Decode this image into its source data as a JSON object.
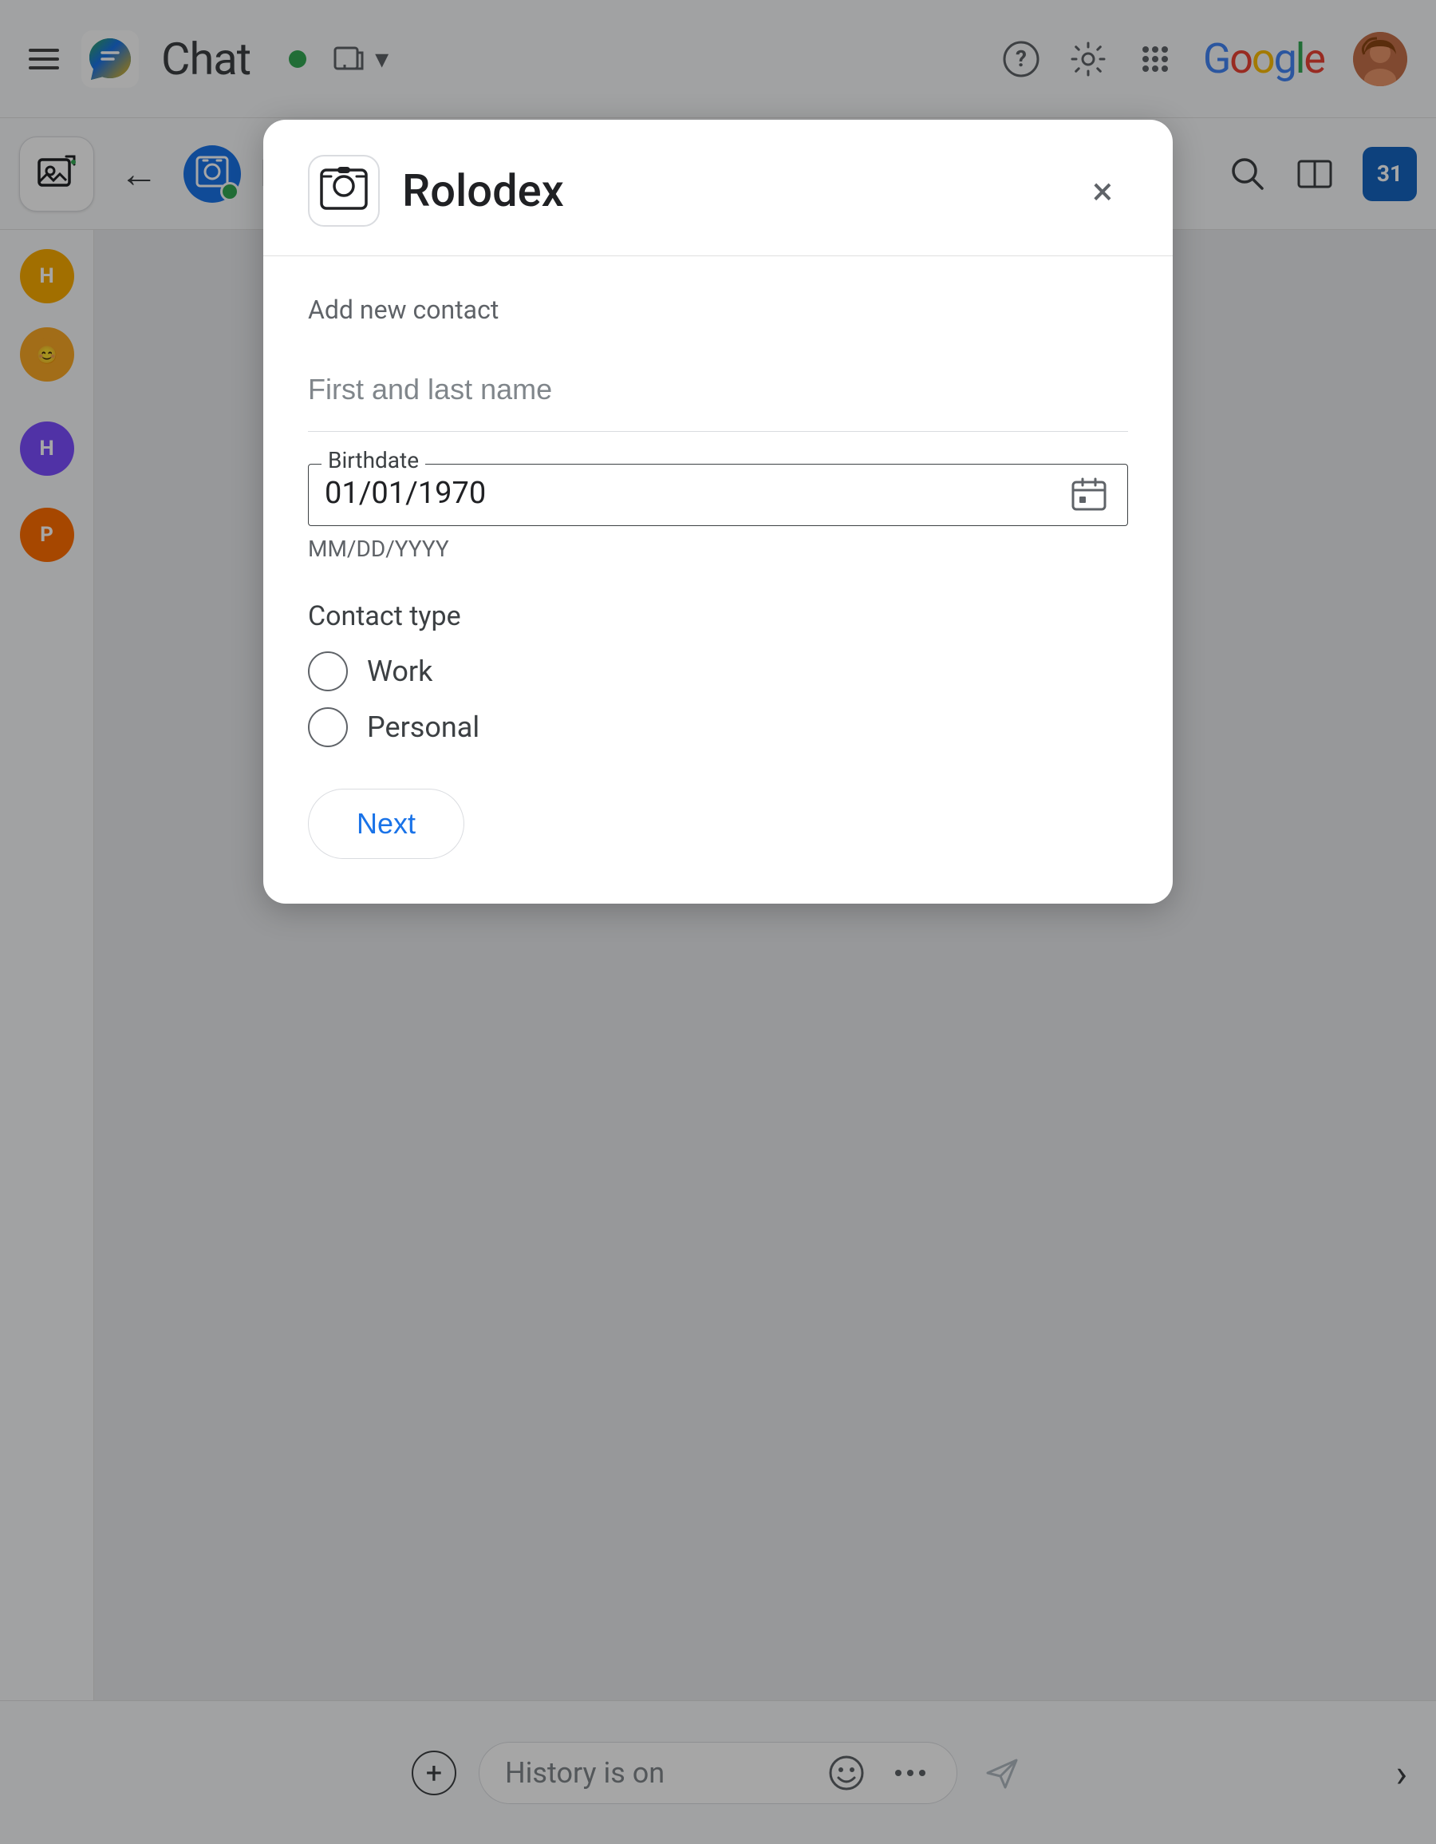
{
  "app": {
    "title": "Chat",
    "logo_alt": "Google Chat logo"
  },
  "topbar": {
    "status": "online",
    "window_label": "window",
    "help_label": "help",
    "settings_label": "settings",
    "apps_label": "apps",
    "google_label": "Google",
    "avatar_alt": "User avatar"
  },
  "secondbar": {
    "contact_name": "Rolodex",
    "search_label": "search",
    "split_label": "split view",
    "calendar_day": "31"
  },
  "sidebar": {
    "items": [
      {
        "label": "H",
        "color": "yellow",
        "aria": "H contact"
      },
      {
        "label": "P",
        "color": "orange",
        "aria": "P contact"
      }
    ]
  },
  "bottom": {
    "input_placeholder": "History is on",
    "add_label": "add attachment",
    "emoji_label": "emoji",
    "more_label": "more options",
    "send_label": "send"
  },
  "modal": {
    "title": "Rolodex",
    "close_label": "×",
    "section_label": "Add new contact",
    "name_placeholder": "First and last name",
    "name_value": "",
    "birthdate_label": "Birthdate",
    "birthdate_value": "01/01/1970",
    "birthdate_format": "MM/DD/YYYY",
    "contact_type_label": "Contact type",
    "contact_types": [
      {
        "id": "work",
        "label": "Work",
        "checked": false
      },
      {
        "id": "personal",
        "label": "Personal",
        "checked": false
      }
    ],
    "next_button": "Next"
  },
  "colors": {
    "accent_blue": "#1a73e8",
    "google_blue": "#4285f4",
    "google_red": "#ea4335",
    "google_yellow": "#fbbc05",
    "google_green": "#34a853"
  }
}
